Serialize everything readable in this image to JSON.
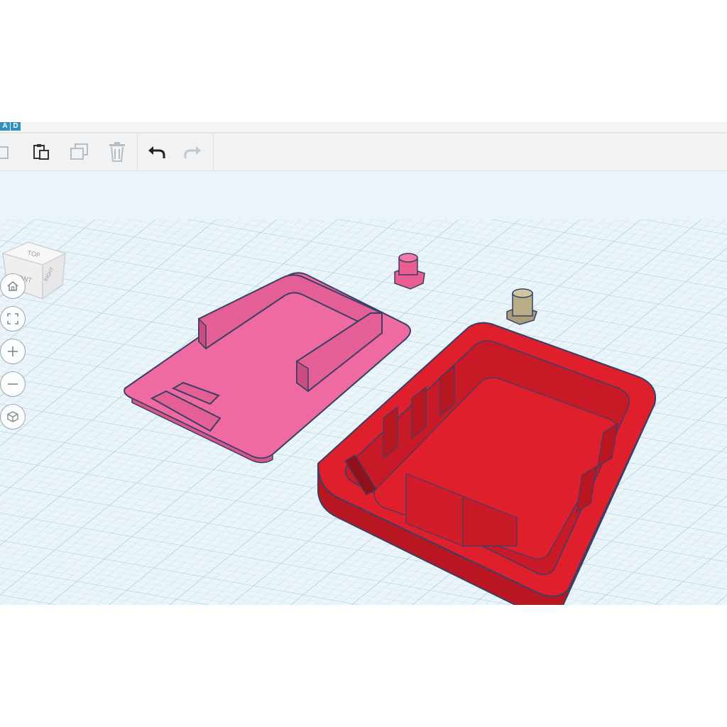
{
  "app": {
    "logo_letters": [
      "A",
      "D"
    ]
  },
  "toolbar": {
    "buttons": [
      {
        "id": "copy",
        "icon": "copy-icon",
        "enabled": false
      },
      {
        "id": "paste",
        "icon": "paste-icon",
        "enabled": true
      },
      {
        "id": "duplicate",
        "icon": "duplicate-icon",
        "enabled": false
      },
      {
        "id": "delete",
        "icon": "trash-icon",
        "enabled": false
      },
      {
        "id": "undo",
        "icon": "undo-icon",
        "enabled": true
      },
      {
        "id": "redo",
        "icon": "redo-icon",
        "enabled": false
      }
    ]
  },
  "viewcube": {
    "top_label": "TOP",
    "front_label": "FRONT",
    "right_label": "RIGHT"
  },
  "view_controls": [
    {
      "id": "home",
      "icon": "home-icon"
    },
    {
      "id": "fit",
      "icon": "fit-view-icon"
    },
    {
      "id": "zoom-in",
      "icon": "zoom-in-icon"
    },
    {
      "id": "zoom-out",
      "icon": "zoom-out-icon"
    },
    {
      "id": "ortho",
      "icon": "perspective-cube-icon"
    }
  ],
  "colors": {
    "lid": "#ee6aa0",
    "lid_dark": "#d8568c",
    "case": "#e01f2d",
    "case_dark": "#b81722",
    "button_pink": "#e95d91",
    "button_olive": "#b8ad86",
    "grid_bg": "#eaf4f9",
    "grid_line": "#9fcde0",
    "accent": "#2f8fc1"
  }
}
